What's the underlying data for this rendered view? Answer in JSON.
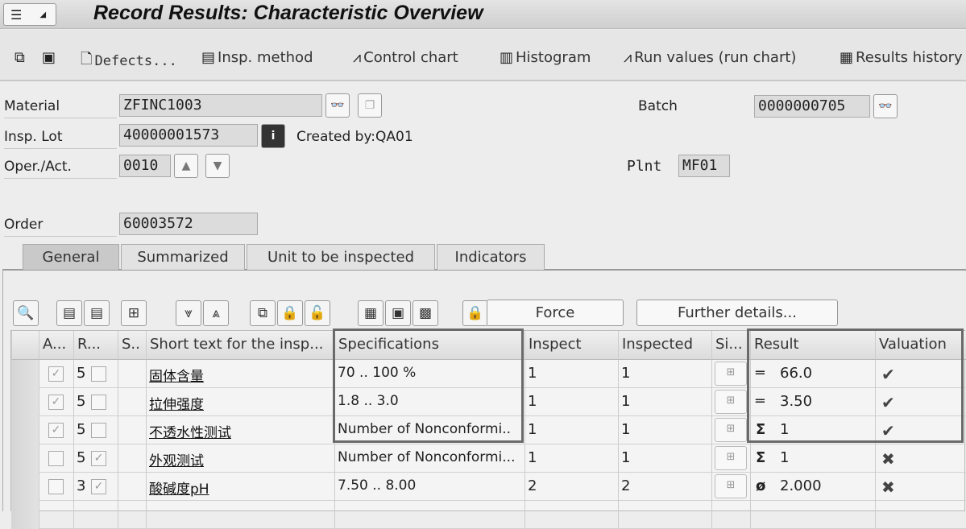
{
  "window": {
    "title": "Record Results: Characteristic Overview"
  },
  "toolbar": {
    "defects": "Defects...",
    "insp_method": "Insp. method",
    "control_chart": "Control chart",
    "histogram": "Histogram",
    "run_values": "Run values (run chart)",
    "results_history": "Results history"
  },
  "header": {
    "material_label": "Material",
    "material_value": "ZFINC1003",
    "insp_lot_label": "Insp. Lot",
    "insp_lot_value": "40000001573",
    "created_by": "Created by:QA01",
    "oper_label": "Oper./Act.",
    "oper_value": "0010",
    "batch_label": "Batch",
    "batch_value": "0000000705",
    "plant_label": "Plnt",
    "plant_value": "MF01",
    "order_label": "Order",
    "order_value": "60003572"
  },
  "tabs": [
    {
      "label": "General",
      "active": true
    },
    {
      "label": "Summarized"
    },
    {
      "label": "Unit to be inspected"
    },
    {
      "label": "Indicators"
    }
  ],
  "grid_toolbar": {
    "force": "Force",
    "further_details": "Further details..."
  },
  "table": {
    "columns": [
      "A...",
      "R...",
      "S..",
      "Short text for the insp...",
      "Specifications",
      "Inspect",
      "Inspected",
      "Si...",
      "Result",
      "Valuation"
    ],
    "rows": [
      {
        "a": true,
        "r": false,
        "s": "5",
        "text": "固体含量",
        "spec": "70 .. 100 %",
        "inspect": "1",
        "inspected": "1",
        "result_icon": "equals-icon",
        "result": "66.0",
        "valuation": "accepted"
      },
      {
        "a": true,
        "r": false,
        "s": "5",
        "text": "拉伸强度",
        "spec": "1.8 .. 3.0",
        "inspect": "1",
        "inspected": "1",
        "result_icon": "equals-icon",
        "result": "3.50",
        "valuation": "accepted"
      },
      {
        "a": true,
        "r": false,
        "s": "5",
        "text": "不透水性测试",
        "spec": "Number of Nonconformi..",
        "inspect": "1",
        "inspected": "1",
        "result_icon": "sigma-icon",
        "result": "1",
        "valuation": "accepted"
      },
      {
        "a": false,
        "r": true,
        "s": "5",
        "text": "外观测试",
        "spec": "Number of Nonconformi...",
        "inspect": "1",
        "inspected": "1",
        "result_icon": "sigma-icon",
        "result": "1",
        "valuation": "rejected"
      },
      {
        "a": false,
        "r": true,
        "s": "3",
        "text": "酸碱度pH",
        "spec": "7.50 .. 8.00",
        "inspect": "2",
        "inspected": "2",
        "result_icon": "average-icon",
        "result": "2.000",
        "valuation": "rejected"
      }
    ]
  }
}
